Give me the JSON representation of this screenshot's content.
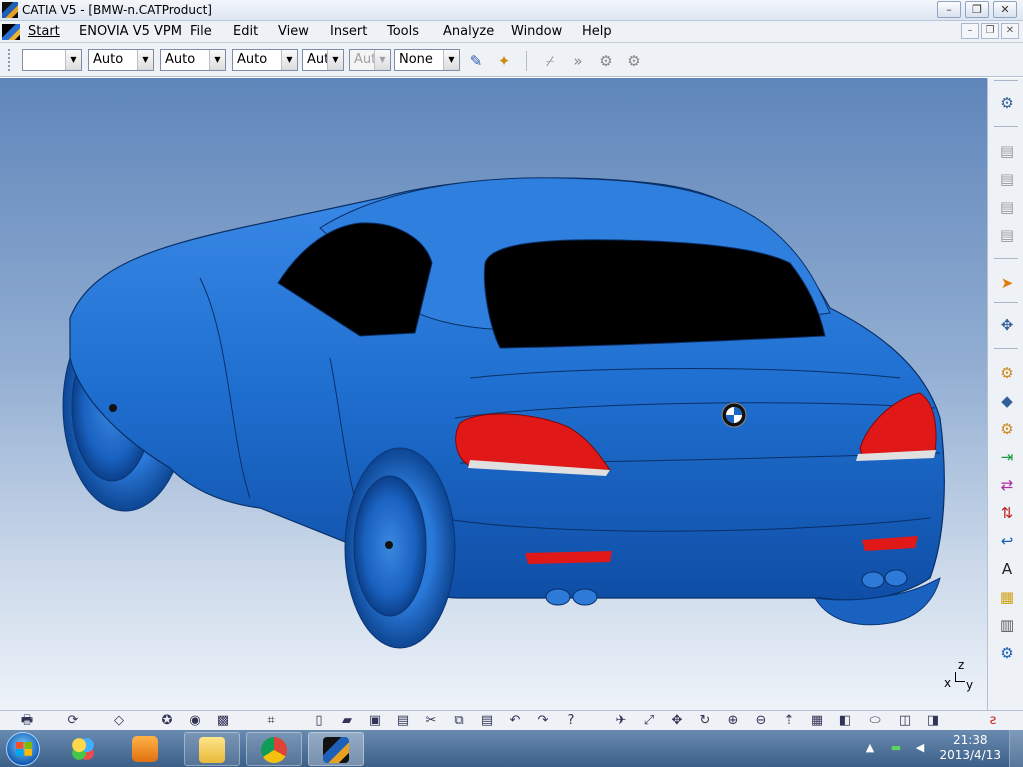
{
  "window": {
    "title": "CATIA V5 - [BMW-n.CATProduct]",
    "minimize": "–",
    "restore": "❐",
    "close": "✕"
  },
  "menubar": {
    "items": [
      "Start",
      "ENOVIA V5 VPM",
      "File",
      "Edit",
      "View",
      "Insert",
      "Tools",
      "Analyze",
      "Window",
      "Help"
    ]
  },
  "toolbar": {
    "combos": [
      {
        "value": ""
      },
      {
        "value": "Auto"
      },
      {
        "value": "Auto"
      },
      {
        "value": "Auto"
      },
      {
        "value": "Aut"
      },
      {
        "value": "Aut",
        "disabled": true
      },
      {
        "value": "None"
      }
    ]
  },
  "viewport": {
    "model": "car-body-3d-model",
    "body_color": "#1f6fd0",
    "taillight_color": "#e01818",
    "axis": {
      "z": "z",
      "x": "x",
      "y": "y"
    }
  },
  "taskbar": {
    "apps": [
      "Windows Media Player",
      "Windows Explorer",
      "Google Chrome",
      "CATIA V5"
    ],
    "time": "21:38",
    "date": "2013/4/13"
  }
}
